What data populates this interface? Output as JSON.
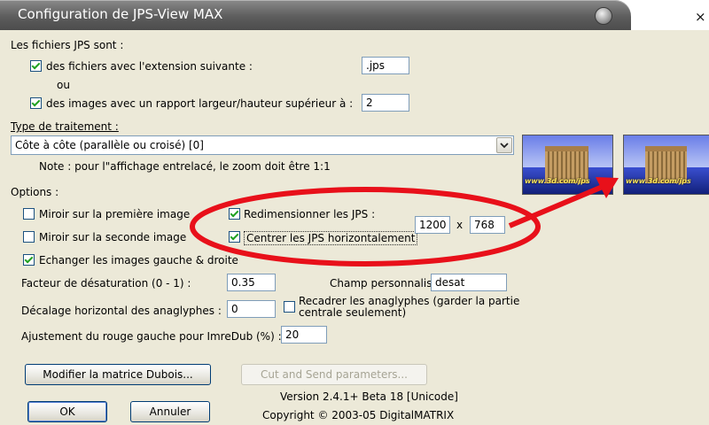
{
  "window": {
    "title": "Configuration de JPS-View MAX",
    "close_glyph": "×"
  },
  "files_section": {
    "heading": "Les fichiers JPS sont :",
    "ext_label": "des fichiers avec l'extension suivante :",
    "ext_value": ".jps",
    "or_label": "ou",
    "ratio_label": "des images avec un rapport largeur/hauteur supérieur à :",
    "ratio_value": "2"
  },
  "treatment": {
    "label": "Type de traitement :",
    "selected": "Côte à côte (parallèle ou croisé)  [0]",
    "note": "Note : pour l\"affichage entrelacé, le zoom doit être 1:1"
  },
  "options": {
    "heading": "Options :",
    "mirror_first": "Miroir sur la première image",
    "mirror_second": "Miroir sur la seconde image",
    "swap": "Echanger les images gauche & droite",
    "resize": "Redimensionner les JPS :",
    "center": "Centrer les JPS horizontalement",
    "width": "1200",
    "times": "x",
    "height": "768",
    "desat_label": "Facteur de désaturation (0 - 1) :",
    "desat_value": "0.35",
    "custom_label": "Champ personnalisé :",
    "custom_value": "desat",
    "anaglyph_offset_label": "Décalage horizontal des anaglyphes :",
    "anaglyph_offset_value": "0",
    "recrop_label": "Recadrer les anaglyphes (garder la partie centrale seulement)",
    "red_adjust_label": "Ajustement du rouge gauche pour ImreDub (%) :",
    "red_adjust_value": "20"
  },
  "buttons": {
    "dubois": "Modifier la matrice Dubois...",
    "cut_send": "Cut and Send parameters...",
    "ok": "OK",
    "cancel": "Annuler"
  },
  "footer": {
    "version": "Version 2.4.1+ Beta 18 [Unicode]",
    "copyright": "Copyright © 2003-05 DigitalMATRIX"
  },
  "thumbnails": {
    "caption": "www.3d.com/jps"
  },
  "colors": {
    "annotation_red": "#e8101a",
    "title_gray": "#6b6b6b",
    "panel": "#ece9d8"
  },
  "icons": [
    "window-menu-icon",
    "close-icon",
    "dropdown-arrow-icon",
    "checkbox-check-icon"
  ]
}
